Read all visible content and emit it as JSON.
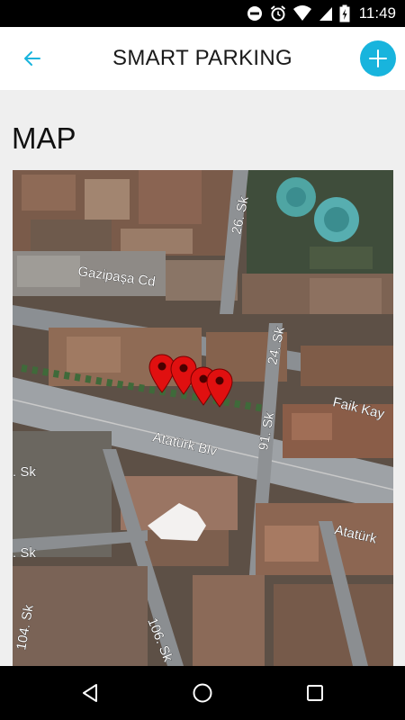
{
  "status_bar": {
    "time": "11:49",
    "icons": [
      "do-not-disturb-icon",
      "alarm-icon",
      "wifi-icon",
      "signal-icon",
      "battery-icon"
    ]
  },
  "app_bar": {
    "title": "SMART PARKING",
    "back_icon": "arrow-left-icon",
    "add_icon": "plus-icon",
    "accent_color": "#18b4dd"
  },
  "section": {
    "title": "MAP"
  },
  "map": {
    "street_labels": [
      "Gazipaşa Cd",
      "26. Sk",
      "24. Sk",
      "Faik Kay",
      "91. Sk",
      "Atatürk Blv",
      "Atatürk",
      ". Sk",
      ". Sk",
      "104. Sk",
      "106. Sk"
    ],
    "marker_count": 4,
    "marker_color": "#e01010",
    "marker_icon": "map-pin-icon"
  },
  "nav_bar": {
    "icons": [
      "back-triangle-icon",
      "home-circle-icon",
      "recents-square-icon"
    ]
  }
}
